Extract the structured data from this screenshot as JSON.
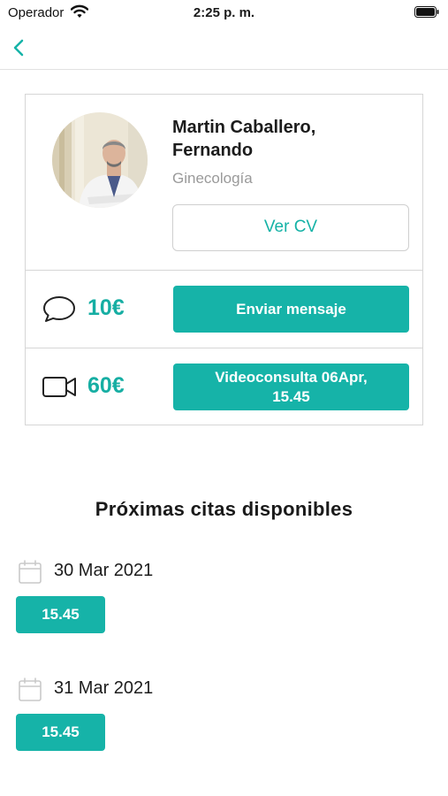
{
  "status_bar": {
    "carrier": "Operador",
    "time": "2:25 p. m."
  },
  "doctor": {
    "name_line1": "Martin Caballero,",
    "name_line2": "Fernando",
    "specialty": "Ginecología",
    "cv_button": "Ver CV"
  },
  "services": [
    {
      "icon": "chat-bubble-icon",
      "price": "10€",
      "button": "Enviar mensaje"
    },
    {
      "icon": "video-camera-icon",
      "price": "60€",
      "button_line1": "Videoconsulta 06Apr,",
      "button_line2": "15.45"
    }
  ],
  "appointments": {
    "title": "Próximas citas disponibles",
    "days": [
      {
        "date": "30 Mar 2021",
        "slot": "15.45"
      },
      {
        "date": "31 Mar 2021",
        "slot": "15.45"
      }
    ]
  },
  "colors": {
    "accent": "#16b3a8",
    "muted": "#9a9a9a",
    "border": "#d6d6d6"
  }
}
